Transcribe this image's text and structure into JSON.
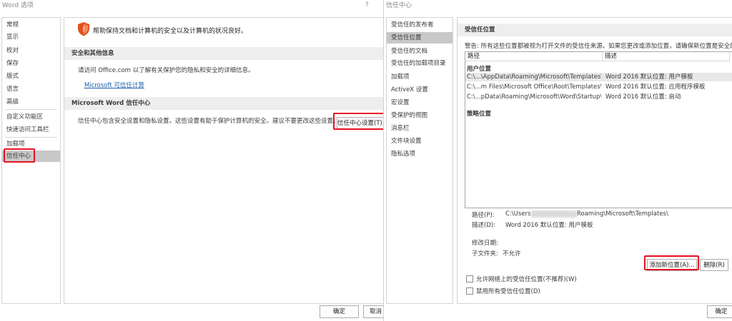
{
  "word_options": {
    "title": "Word 选项",
    "help": "?",
    "nav": [
      {
        "label": "常规"
      },
      {
        "label": "显示"
      },
      {
        "label": "校对"
      },
      {
        "label": "保存"
      },
      {
        "label": "版式"
      },
      {
        "label": "语言"
      },
      {
        "label": "高级"
      },
      {
        "label": "自定义功能区"
      },
      {
        "label": "快速访问工具栏"
      },
      {
        "label": "加载项"
      },
      {
        "label": "信任中心"
      }
    ],
    "banner": "帮助保持文档和计算机的安全以及计算机的状况良好。",
    "section_security": "安全和其他信息",
    "security_text": "请访问 Office.com 以了解有关保护您的隐私和安全的详细信息。",
    "security_link": "Microsoft 可信任计算",
    "section_trust": "Microsoft Word 信任中心",
    "trust_text": "信任中心包含安全设置和隐私设置。这些设置有助于保护计算机的安全。建议不要更改这些设置。",
    "trust_button": "信任中心设置(T)...",
    "ok": "确定",
    "cancel": "取消"
  },
  "trust_center": {
    "title": "信任中心",
    "nav": [
      {
        "label": "受信任的发布者"
      },
      {
        "label": "受信任位置"
      },
      {
        "label": "受信任的文档"
      },
      {
        "label": "受信任的加载项目录"
      },
      {
        "label": "加载项"
      },
      {
        "label": "ActiveX 设置"
      },
      {
        "label": "宏设置"
      },
      {
        "label": "受保护的视图"
      },
      {
        "label": "消息栏"
      },
      {
        "label": "文件块设置"
      },
      {
        "label": "隐私选项"
      }
    ],
    "section": "受信任位置",
    "warning": "警告: 所有这些位置都被视为打开文件的受信任来源。如果您更改或添加位置，请确保新位置是安全的。",
    "col_path": "路径",
    "col_desc": "描述",
    "user_group": "用户位置",
    "rows": [
      {
        "path": "C:\\...\\AppData\\Roaming\\Microsoft\\Templates\\",
        "desc": "Word 2016 默认位置: 用户模板"
      },
      {
        "path": "C:\\...m Files\\Microsoft Office\\Root\\Templates\\",
        "desc": "Word 2016 默认位置: 应用程序模板"
      },
      {
        "path": "C:\\...pData\\Roaming\\Microsoft\\Word\\Startup\\",
        "desc": "Word 2016 默认位置: 启动"
      }
    ],
    "policy_group": "策略位置",
    "path_label": "路径(P):",
    "path_value_prefix": "C:\\Users",
    "path_value_suffix": "Roaming\\Microsoft\\Templates\\",
    "desc_label": "描述(D):",
    "desc_value": "Word 2016 默认位置: 用户模板",
    "modified_label": "修改日期:",
    "subfolder_label": "子文件夹:",
    "subfolder_value": "不允许",
    "add_button": "添加新位置(A)...",
    "remove_button": "删除(R)",
    "cb_network": "允许网络上的受信任位置(不推荐)(W)",
    "cb_disable": "禁用所有受信任位置(D)",
    "ok": "确定"
  },
  "colors": {
    "highlight": "#e81123",
    "shield": "#e0531f",
    "link": "#1d5ea9"
  }
}
